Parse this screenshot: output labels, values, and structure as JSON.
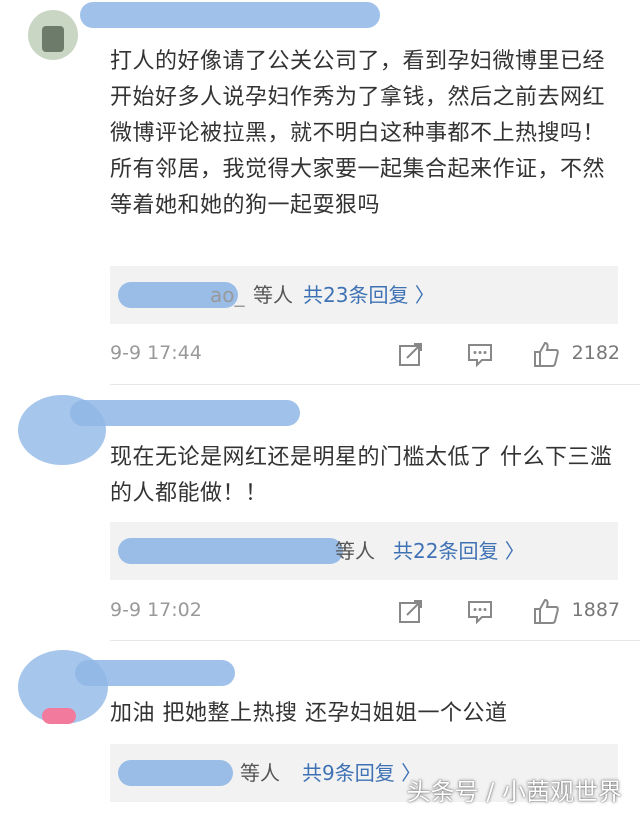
{
  "comments": [
    {
      "text": "打人的好像请了公关公司了，看到孕妇微博里已经开始好多人说孕妇作秀为了拿钱，然后之前去网红微博评论被拉黑，就不明白这种事都不上热搜吗！所有邻居，我觉得大家要一起集合起来作证，不然等着她和她的狗一起耍狠吗",
      "reply_names": "ao_",
      "reply_etc": "等人",
      "reply_count": "共23条回复 〉",
      "time": "9-9 17:44",
      "likes": "2182"
    },
    {
      "text": "现在无论是网红还是明星的门槛太低了 什么下三滥的人都能做！！",
      "reply_names": "",
      "reply_etc": "等人",
      "reply_count": "共22条回复 〉",
      "time": "9-9 17:02",
      "likes": "1887"
    },
    {
      "text": "加油 把她整上热搜 还孕妇姐姐一个公道",
      "reply_names": "",
      "reply_etc": "等人",
      "reply_count": "共9条回复 〉"
    }
  ],
  "watermark": "头条号 / 小茜观世界",
  "colors": {
    "link": "#3f72b5",
    "scribble": "#8fb7e6",
    "meta": "#999999"
  },
  "icons": [
    "share-icon",
    "comment-icon",
    "like-icon"
  ]
}
